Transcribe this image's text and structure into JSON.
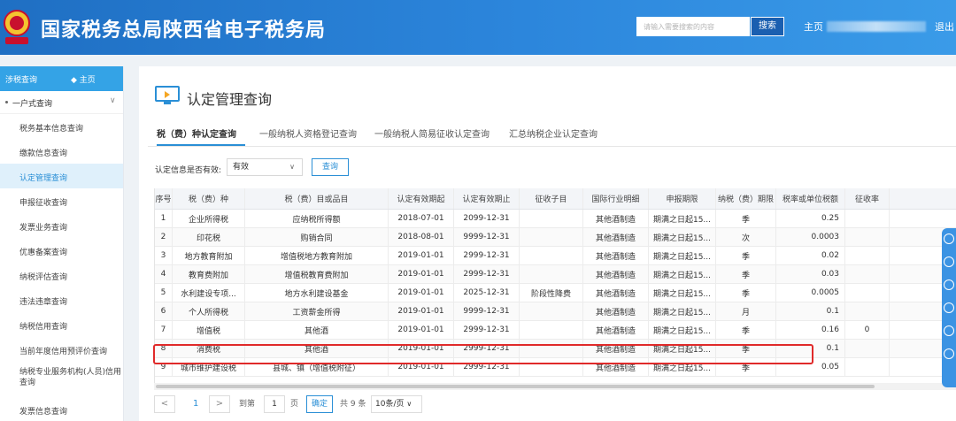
{
  "header": {
    "site_title": "国家税务总局陕西省电子税务局",
    "search_placeholder": "请输入需要搜索的内容",
    "search_button": "搜索",
    "home_link": "主页",
    "logout_link": "退出"
  },
  "sidebar": {
    "head_title": "涉税查询",
    "head_home": "主页",
    "group_label": "一户式查询",
    "items": [
      "税务基本信息查询",
      "缴款信息查询",
      "认定管理查询",
      "申报征收查询",
      "发票业务查询",
      "优惠备案查询",
      "纳税评估查询",
      "违法违章查询",
      "纳税信用查询",
      "当前年度信用预评价查询",
      "纳税专业服务机构(人员)信用查询",
      "发票信息查询"
    ],
    "active_index": 2
  },
  "main": {
    "page_title": "认定管理查询",
    "tabs": [
      "税（费）种认定查询",
      "一般纳税人资格登记查询",
      "一般纳税人简易征收认定查询",
      "汇总纳税企业认定查询"
    ],
    "active_tab": 0,
    "filter_label": "认定信息是否有效:",
    "filter_value": "有效",
    "query_button": "查询"
  },
  "table": {
    "columns": [
      "序号",
      "税（费）种",
      "税（费）目或品目",
      "认定有效期起",
      "认定有效期止",
      "征收子目",
      "国际行业明细",
      "申报期限",
      "纳税（费）期限",
      "税率或单位税额",
      "征收率"
    ],
    "rows": [
      [
        "1",
        "企业所得税",
        "应纳税所得额",
        "2018-07-01",
        "2099-12-31",
        "",
        "其他酒制造",
        "期满之日起15...",
        "季",
        "0.25",
        ""
      ],
      [
        "2",
        "印花税",
        "购销合同",
        "2018-08-01",
        "9999-12-31",
        "",
        "其他酒制造",
        "期满之日起15...",
        "次",
        "0.0003",
        ""
      ],
      [
        "3",
        "地方教育附加",
        "增值税地方教育附加",
        "2019-01-01",
        "2999-12-31",
        "",
        "其他酒制造",
        "期满之日起15...",
        "季",
        "0.02",
        ""
      ],
      [
        "4",
        "教育费附加",
        "增值税教育费附加",
        "2019-01-01",
        "2999-12-31",
        "",
        "其他酒制造",
        "期满之日起15...",
        "季",
        "0.03",
        ""
      ],
      [
        "5",
        "水利建设专项...",
        "地方水利建设基金",
        "2019-01-01",
        "2025-12-31",
        "阶段性降费",
        "其他酒制造",
        "期满之日起15...",
        "季",
        "0.0005",
        ""
      ],
      [
        "6",
        "个人所得税",
        "工资薪金所得",
        "2019-01-01",
        "9999-12-31",
        "",
        "其他酒制造",
        "期满之日起15...",
        "月",
        "0.1",
        ""
      ],
      [
        "7",
        "增值税",
        "其他酒",
        "2019-01-01",
        "2999-12-31",
        "",
        "其他酒制造",
        "期满之日起15...",
        "季",
        "0.16",
        "0"
      ],
      [
        "8",
        "消费税",
        "其他酒",
        "2019-01-01",
        "2999-12-31",
        "",
        "其他酒制造",
        "期满之日起15...",
        "季",
        "0.1",
        ""
      ],
      [
        "9",
        "城市维护建设税",
        "县城、镇（增值税附征）",
        "2019-01-01",
        "2999-12-31",
        "",
        "其他酒制造",
        "期满之日起15...",
        "季",
        "0.05",
        ""
      ]
    ],
    "highlighted_row": 7
  },
  "pagination": {
    "prev": "<",
    "current_page": "1",
    "next": ">",
    "goto_label": "到第",
    "goto_value": "1",
    "page_unit": "页",
    "confirm": "确定",
    "total": "共 9 条",
    "page_size": "10条/页"
  },
  "colors": {
    "header_blue": "#2a7fd4",
    "accent": "#2a8fd6",
    "highlight_red": "#e02a2a"
  }
}
